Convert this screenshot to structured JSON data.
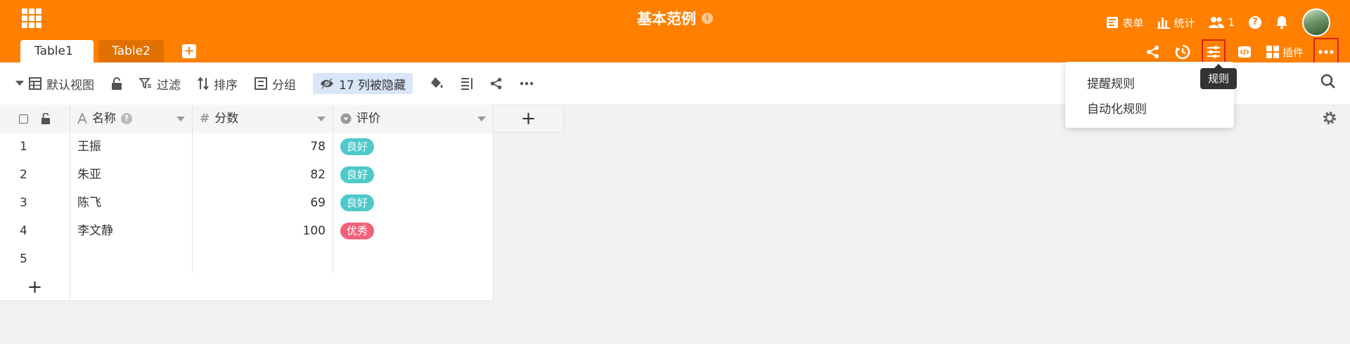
{
  "header": {
    "base_title": "基本范例",
    "info_glyph": "i",
    "items": {
      "form_label": "表单",
      "stats_label": "统计",
      "collaborators_count": "1",
      "help_glyph": "?"
    }
  },
  "tabs": [
    {
      "label": "Table1",
      "active": true
    },
    {
      "label": "Table2",
      "active": false
    }
  ],
  "toolbar_right": {
    "plugins_label": "插件"
  },
  "view_toolbar": {
    "view_name": "默认视图",
    "filter_label": "过滤",
    "sort_label": "排序",
    "group_label": "分组",
    "hidden_columns_label": "17 列被隐藏"
  },
  "table": {
    "columns": [
      {
        "label": "名称",
        "type": "text"
      },
      {
        "label": "分数",
        "type": "number"
      },
      {
        "label": "评价",
        "type": "single-select"
      }
    ],
    "rows": [
      {
        "index": "1",
        "name": "王振",
        "score": "78",
        "rating": "良好",
        "rating_color": "#4ec9c9"
      },
      {
        "index": "2",
        "name": "朱亚",
        "score": "82",
        "rating": "良好",
        "rating_color": "#4ec9c9"
      },
      {
        "index": "3",
        "name": "陈飞",
        "score": "69",
        "rating": "良好",
        "rating_color": "#4ec9c9"
      },
      {
        "index": "4",
        "name": "李文静",
        "score": "100",
        "rating": "优秀",
        "rating_color": "#f2617a"
      },
      {
        "index": "5",
        "name": "",
        "score": "",
        "rating": "",
        "rating_color": ""
      }
    ],
    "add_glyph": "+"
  },
  "rules_dropdown": {
    "items": [
      "提醒规则",
      "自动化规则"
    ]
  },
  "tooltip": {
    "text": "规则"
  },
  "colors": {
    "brand": "#ff8000",
    "hidden_columns_bg": "#d9e6f7",
    "highlight_outline": "#d9231b"
  }
}
